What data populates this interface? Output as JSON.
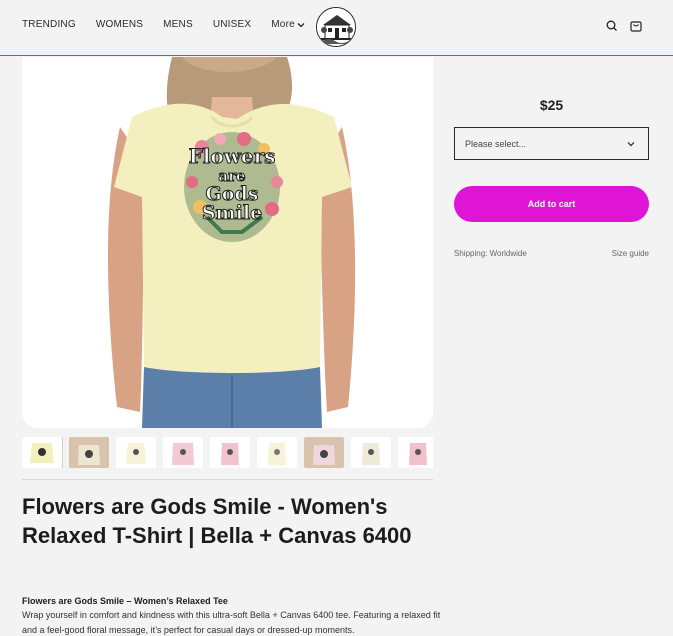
{
  "nav": {
    "items": [
      {
        "label": "TRENDING"
      },
      {
        "label": "WOMENS"
      },
      {
        "label": "MENS"
      },
      {
        "label": "UNISEX"
      }
    ],
    "more_label": "More"
  },
  "header": {
    "icons": [
      "search-icon",
      "cart-icon"
    ]
  },
  "product": {
    "image_text": {
      "line1": "Flowers",
      "line2": "are",
      "line3": "Gods",
      "line4": "Smile"
    },
    "title": "Flowers are Gods Smile - Women's Relaxed T-Shirt | Bella + Canvas 6400",
    "desc_heading": "Flowers are Gods Smile – Women’s Relaxed Tee",
    "desc_text": "Wrap yourself in comfort and kindness with this ultra-soft Bella + Canvas 6400 tee. Featuring a relaxed fit and a feel-good floral message, it’s perfect for casual days or dressed-up moments.",
    "thumbnail_count": 9
  },
  "purchase": {
    "price": "$25",
    "select_placeholder": "Please select...",
    "add_to_cart_label": "Add to cart",
    "shipping_text": "Shipping: Worldwide",
    "size_guide_label": "Size guide"
  },
  "colors": {
    "accent": "#e014d5",
    "background": "#f3f3f4",
    "shirt": "#f3efbe"
  }
}
